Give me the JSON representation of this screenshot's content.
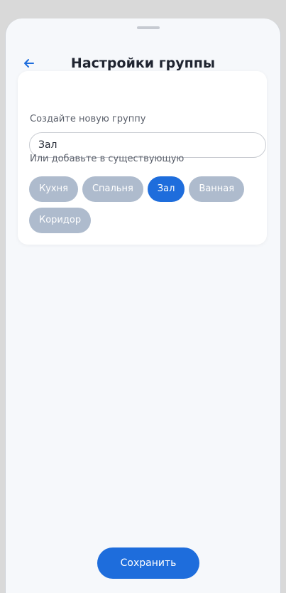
{
  "header": {
    "title": "Настройки группы",
    "back_icon": "arrow-left-icon"
  },
  "form": {
    "new_group_label": "Создайте новую группу",
    "new_group_value": "Зал",
    "existing_label": "Или добавьте в существующую",
    "groups": [
      {
        "label": "Кухня",
        "selected": false
      },
      {
        "label": "Спальня",
        "selected": false
      },
      {
        "label": "Зал",
        "selected": true
      },
      {
        "label": "Ванная",
        "selected": false
      },
      {
        "label": "Коридор",
        "selected": false
      }
    ]
  },
  "actions": {
    "save_label": "Сохранить"
  },
  "colors": {
    "accent": "#1e6ddc",
    "chip_inactive": "#aebbcd",
    "background": "#f6f8fb"
  }
}
